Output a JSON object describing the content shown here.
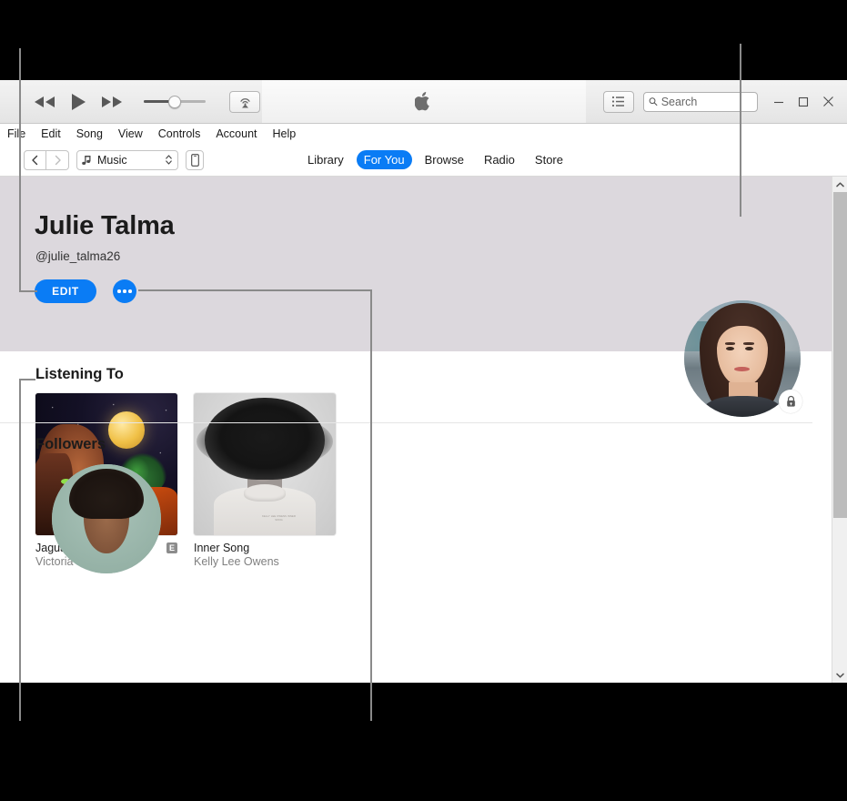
{
  "window": {
    "titlebar_buttons": [
      "minimize",
      "maximize",
      "close"
    ]
  },
  "toolbar": {
    "rewind_label": "Rewind",
    "play_label": "Play",
    "forward_label": "Fast Forward",
    "volume_label": "Volume",
    "airplay_label": "AirPlay",
    "apple_logo_label": "Apple",
    "list_view_label": "Up Next",
    "search": {
      "placeholder": "Search",
      "value": ""
    }
  },
  "menubar": {
    "items": [
      "File",
      "Edit",
      "Song",
      "View",
      "Controls",
      "Account",
      "Help"
    ]
  },
  "navbar": {
    "back_label": "Back",
    "forward_label": "Forward",
    "library_select": {
      "value": "Music",
      "icon": "music-note-icon"
    },
    "device_label": "Device",
    "tabs": [
      {
        "label": "Library",
        "active": false
      },
      {
        "label": "For You",
        "active": true
      },
      {
        "label": "Browse",
        "active": false
      },
      {
        "label": "Radio",
        "active": false
      },
      {
        "label": "Store",
        "active": false
      }
    ]
  },
  "profile": {
    "name": "Julie Talma",
    "handle": "@julie_talma26",
    "edit_label": "EDIT",
    "more_label": "More options",
    "avatar_label": "Profile photo",
    "privacy_badge": "lock-icon"
  },
  "listening_to": {
    "title": "Listening To",
    "albums": [
      {
        "title": "Jaguar",
        "artist": "Victoria Monét",
        "explicit": "E"
      },
      {
        "title": "Inner Song",
        "artist": "Kelly Lee Owens",
        "explicit": ""
      }
    ]
  },
  "followers": {
    "title": "Followers"
  },
  "colors": {
    "accent": "#0a7cf5",
    "profile_header_bg": "#dcd8dd",
    "callout_line": "#8a8a8a",
    "page_bg": "#000000"
  },
  "inner_song_cover_text": "KELLY LEE OWENS INNER SONG"
}
